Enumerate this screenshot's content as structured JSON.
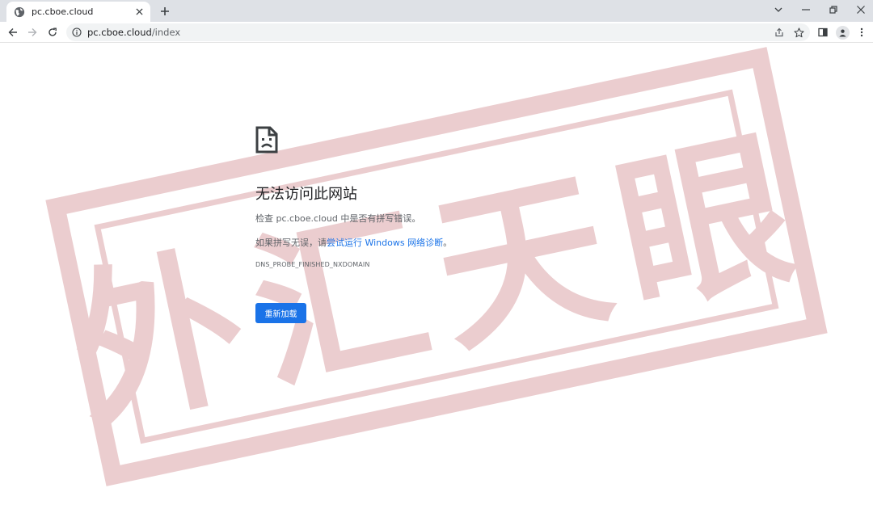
{
  "tab": {
    "title": "pc.cboe.cloud",
    "favicon": "globe-icon"
  },
  "toolbar": {
    "url_host": "pc.cboe.cloud",
    "url_path": "/index"
  },
  "error": {
    "title": "无法访问此网站",
    "check_prefix": "检查 ",
    "check_host": "pc.cboe.cloud",
    "check_suffix": " 中是否有拼写错误。",
    "hint_prefix": "如果拼写无误，请",
    "hint_link": "尝试运行 Windows 网络诊断",
    "hint_suffix": "。",
    "code": "DNS_PROBE_FINISHED_NXDOMAIN",
    "reload_label": "重新加载"
  },
  "watermark": {
    "text": "外汇天眼",
    "color": "#d9a0a3"
  },
  "colors": {
    "accent": "#1a73e8",
    "tabstrip": "#dee1e6",
    "omnibox": "#f1f3f4"
  }
}
